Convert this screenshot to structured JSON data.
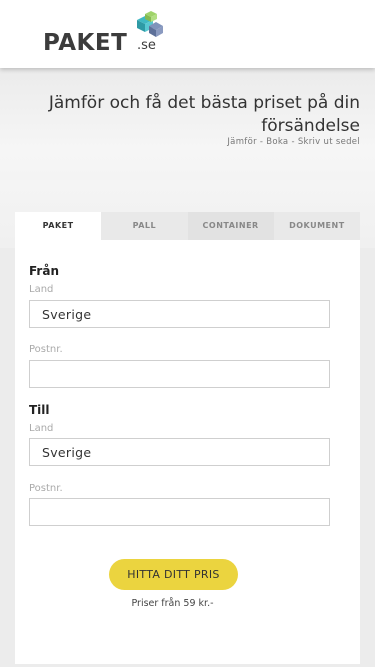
{
  "header": {
    "logo_text": "PAKET",
    "logo_suffix": ".se",
    "brand_colors": {
      "cube_teal": "#3fb8c3",
      "cube_green": "#9fd36a",
      "cube_blue": "#6a7ea8",
      "cube_gray": "#8a8f99"
    }
  },
  "hero": {
    "title": "Jämför och få det bästa priset på din försändelse",
    "subtitle": "Jämför - Boka - Skriv ut sedel"
  },
  "tabs": [
    {
      "label": "PAKET",
      "active": true
    },
    {
      "label": "PALL",
      "active": false
    },
    {
      "label": "CONTAINER",
      "active": false
    },
    {
      "label": "DOKUMENT",
      "active": false
    }
  ],
  "form": {
    "from": {
      "heading": "Från",
      "country_label": "Land",
      "country_value": "Sverige",
      "postal_label": "Postnr.",
      "postal_value": ""
    },
    "to": {
      "heading": "Till",
      "country_label": "Land",
      "country_value": "Sverige",
      "postal_label": "Postnr.",
      "postal_value": ""
    },
    "submit_label": "HITTA DITT PRIS",
    "price_note": "Priser från 59 kr.-"
  },
  "colors": {
    "accent_button": "#ebd43f",
    "background": "#ececec"
  }
}
